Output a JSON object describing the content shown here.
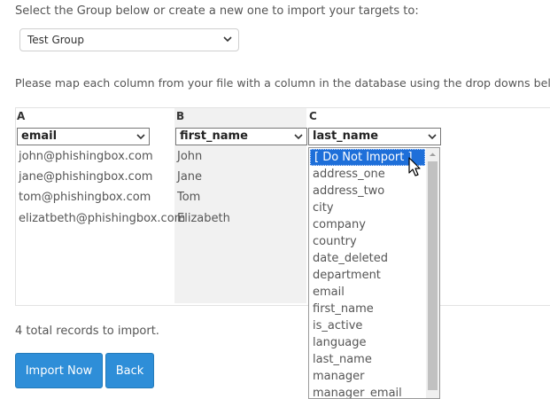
{
  "intro_text": "Select the Group below or create a new one to import your targets to:",
  "group_select": {
    "value": "Test Group"
  },
  "mapping_text": "Please map each column from your file with a column in the database using the drop downs below.",
  "columns": [
    {
      "letter": "A",
      "mapped": "email",
      "cells": [
        "john@phishingbox.com",
        "jane@phishingbox.com",
        "tom@phishingbox.com",
        "elizatbeth@phishingbox.com"
      ]
    },
    {
      "letter": "B",
      "mapped": "first_name",
      "cells": [
        "John",
        "Jane",
        "Tom",
        "Elizabeth"
      ]
    },
    {
      "letter": "C",
      "mapped": "last_name",
      "cells": []
    }
  ],
  "dropdown_options": [
    "[ Do Not Import ]",
    "address_one",
    "address_two",
    "city",
    "company",
    "country",
    "date_deleted",
    "department",
    "email",
    "first_name",
    "is_active",
    "language",
    "last_name",
    "manager",
    "manager_email"
  ],
  "dropdown_selected_index": 0,
  "records_text": "4 total records to import.",
  "buttons": {
    "import": "Import Now",
    "back": "Back"
  },
  "colors": {
    "primary": "#2e8ed8",
    "selected_option": "#1e6fd9"
  },
  "icons": {
    "dropdown": "chevron-down-icon",
    "cursor": "mouse-pointer-icon"
  }
}
